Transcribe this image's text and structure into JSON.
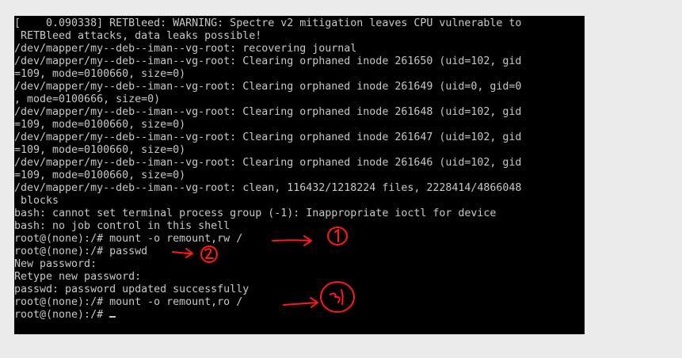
{
  "terminal": {
    "lines": [
      "[    0.090338] RETBleed: WARNING: Spectre v2 mitigation leaves CPU vulnerable to",
      " RETBleed attacks, data leaks possible!",
      "/dev/mapper/my--deb--iman--vg-root: recovering journal",
      "/dev/mapper/my--deb--iman--vg-root: Clearing orphaned inode 261650 (uid=102, gid",
      "=109, mode=0100660, size=0)",
      "/dev/mapper/my--deb--iman--vg-root: Clearing orphaned inode 261649 (uid=0, gid=0",
      ", mode=0100666, size=0)",
      "/dev/mapper/my--deb--iman--vg-root: Clearing orphaned inode 261648 (uid=102, gid",
      "=109, mode=0100660, size=0)",
      "/dev/mapper/my--deb--iman--vg-root: Clearing orphaned inode 261647 (uid=102, gid",
      "=109, mode=0100660, size=0)",
      "/dev/mapper/my--deb--iman--vg-root: Clearing orphaned inode 261646 (uid=102, gid",
      "=109, mode=0100660, size=0)",
      "/dev/mapper/my--deb--iman--vg-root: clean, 116432/1218224 files, 2228414/4866048",
      " blocks",
      "bash: cannot set terminal process group (-1): Inappropriate ioctl for device",
      "bash: no job control in this shell",
      "root@(none):/# mount -o remount,rw /",
      "root@(none):/# passwd",
      "New password:",
      "Retype new password:",
      "passwd: password updated successfully",
      "root@(none):/# mount -o remount,ro /"
    ],
    "prompt": "root@(none):/# "
  },
  "colors": {
    "page_background": "#ebebeb",
    "terminal_background": "#000000",
    "terminal_text": "#c8c8c8",
    "annotation": "#ff1a1a"
  },
  "annotations": [
    {
      "name": "step-1",
      "shape": "arrow-and-circled-digit"
    },
    {
      "name": "step-2",
      "shape": "arrow-and-circled-digit"
    },
    {
      "name": "step-3",
      "shape": "arrow-and-circled-digit"
    }
  ]
}
